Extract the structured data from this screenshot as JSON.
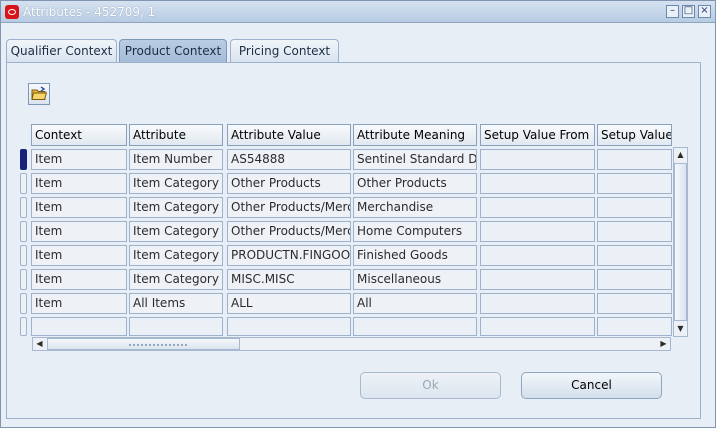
{
  "window": {
    "title": "Attributes - 452709, 1",
    "controls": [
      "minimize-icon",
      "maximize-icon",
      "close-icon"
    ]
  },
  "tabs": [
    {
      "label": "Qualifier Context",
      "active": false
    },
    {
      "label": "Product Context",
      "active": true
    },
    {
      "label": "Pricing Context",
      "active": false
    }
  ],
  "toolbar": {
    "folder_icon": "folder-open-icon"
  },
  "table": {
    "headers": [
      "Context",
      "Attribute",
      "Attribute Value",
      "Attribute Meaning",
      "Setup Value From",
      "Setup Value"
    ],
    "rows": [
      [
        "Item",
        "Item Number",
        "AS54888",
        "Sentinel Standard De",
        "",
        ""
      ],
      [
        "Item",
        "Item Category",
        "Other Products",
        "Other Products",
        "",
        ""
      ],
      [
        "Item",
        "Item Category",
        "Other Products/Merc",
        "Merchandise",
        "",
        ""
      ],
      [
        "Item",
        "Item Category",
        "Other Products/Merc",
        "Home Computers",
        "",
        ""
      ],
      [
        "Item",
        "Item Category",
        "PRODUCTN.FINGOO",
        "Finished Goods",
        "",
        ""
      ],
      [
        "Item",
        "Item Category",
        "MISC.MISC",
        "Miscellaneous",
        "",
        ""
      ],
      [
        "Item",
        "All Items",
        "ALL",
        "All",
        "",
        ""
      ],
      [
        "",
        "",
        "",
        "",
        "",
        ""
      ]
    ],
    "current_row": 0
  },
  "buttons": {
    "ok_label": "Ok",
    "cancel_label": "Cancel"
  },
  "colors": {
    "window_bg": "#e8eef5",
    "active_tab": "#a3bbd7",
    "current_row_indicator": "#16247a",
    "app_icon": "#d8141b"
  }
}
